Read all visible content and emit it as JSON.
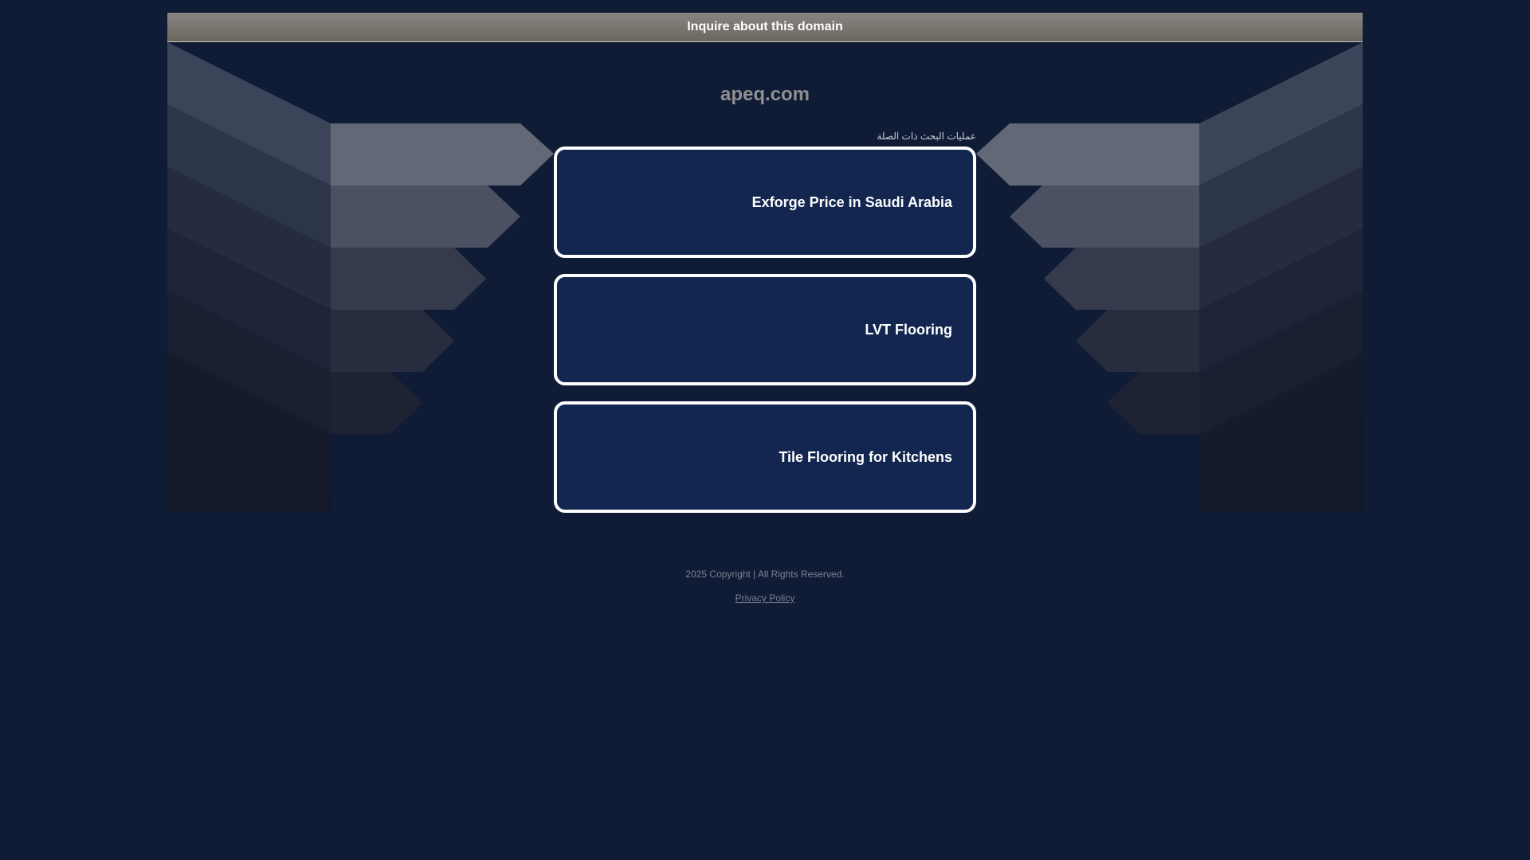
{
  "header": {
    "inquire_label": "Inquire about this domain"
  },
  "domain": {
    "name": "apeq.com"
  },
  "related": {
    "label": "عمليات البحث ذات الصلة",
    "links": [
      {
        "label": "Exforge Price in Saudi Arabia"
      },
      {
        "label": "LVT Flooring"
      },
      {
        "label": "Tile Flooring for Kitchens"
      }
    ]
  },
  "footer": {
    "copyright": "2025 Copyright | All Rights Reserved.",
    "privacy_label": "Privacy Policy"
  },
  "colors": {
    "background": "#101c36",
    "link_box": "#12264f",
    "link_border": "#ffffff",
    "top_bar": "#7a7670"
  }
}
